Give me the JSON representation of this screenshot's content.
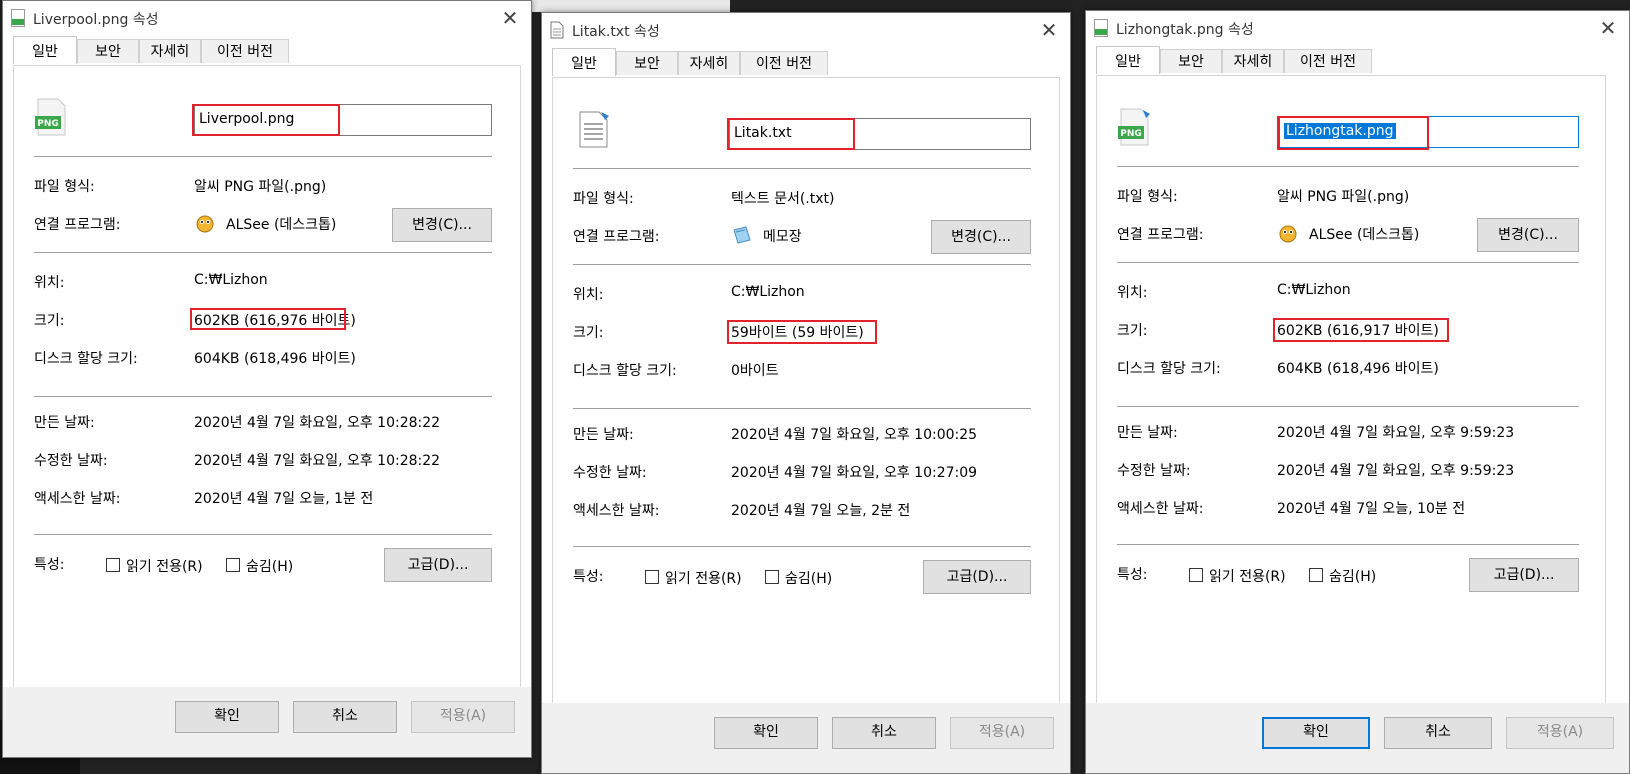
{
  "windows": [
    {
      "title": "Liverpool.png 속성",
      "file_name": "Liverpool.png",
      "icon": "png-file-icon",
      "file_type_label": "파일 형식:",
      "file_type": "알씨 PNG 파일(.png)",
      "opens_with_label": "연결 프로그램:",
      "opens_with": "ALSee (데스크톱)",
      "opens_with_icon": "alsee-app-icon",
      "change_button": "변경(C)...",
      "location_label": "위치:",
      "location": "C:₩Lizhon",
      "size_label": "크기:",
      "size": "602KB (616,976 바이트)",
      "disk_size_label": "디스크 할당 크기:",
      "disk_size": "604KB (618,496 바이트)",
      "created_label": "만든 날짜:",
      "created": "2020년 4월 7일 화요일, 오후 10:28:22",
      "modified_label": "수정한 날짜:",
      "modified": "2020년 4월 7일 화요일, 오후 10:28:22",
      "accessed_label": "액세스한 날짜:",
      "accessed": "2020년 4월 7일 오늘, 1분 전",
      "attributes_label": "특성:",
      "readonly_label": "읽기 전용(R)",
      "hidden_label": "숨김(H)",
      "advanced_button": "고급(D)...",
      "ok_button": "확인",
      "cancel_button": "취소",
      "apply_button": "적용(A)"
    },
    {
      "title": "Litak.txt 속성",
      "file_name": "Litak.txt",
      "icon": "text-file-icon",
      "file_type_label": "파일 형식:",
      "file_type": "텍스트 문서(.txt)",
      "opens_with_label": "연결 프로그램:",
      "opens_with": "메모장",
      "opens_with_icon": "notepad-app-icon",
      "change_button": "변경(C)...",
      "location_label": "위치:",
      "location": "C:₩Lizhon",
      "size_label": "크기:",
      "size": "59바이트 (59 바이트)",
      "disk_size_label": "디스크 할당 크기:",
      "disk_size": "0바이트",
      "created_label": "만든 날짜:",
      "created": "2020년 4월 7일 화요일, 오후 10:00:25",
      "modified_label": "수정한 날짜:",
      "modified": "2020년 4월 7일 화요일, 오후 10:27:09",
      "accessed_label": "액세스한 날짜:",
      "accessed": "2020년 4월 7일 오늘, 2분 전",
      "attributes_label": "특성:",
      "readonly_label": "읽기 전용(R)",
      "hidden_label": "숨김(H)",
      "advanced_button": "고급(D)...",
      "ok_button": "확인",
      "cancel_button": "취소",
      "apply_button": "적용(A)"
    },
    {
      "title": "Lizhongtak.png 속성",
      "file_name": "Lizhongtak.png",
      "icon": "png-file-icon",
      "file_type_label": "파일 형식:",
      "file_type": "알씨 PNG 파일(.png)",
      "opens_with_label": "연결 프로그램:",
      "opens_with": "ALSee (데스크톱)",
      "opens_with_icon": "alsee-app-icon",
      "change_button": "변경(C)...",
      "location_label": "위치:",
      "location": "C:₩Lizhon",
      "size_label": "크기:",
      "size": "602KB (616,917 바이트)",
      "disk_size_label": "디스크 할당 크기:",
      "disk_size": "604KB (618,496 바이트)",
      "created_label": "만든 날짜:",
      "created": "2020년 4월 7일 화요일, 오후 9:59:23",
      "modified_label": "수정한 날짜:",
      "modified": "2020년 4월 7일 화요일, 오후 9:59:23",
      "accessed_label": "액세스한 날짜:",
      "accessed": "2020년 4월 7일 오늘, 10분 전",
      "attributes_label": "특성:",
      "readonly_label": "읽기 전용(R)",
      "hidden_label": "숨김(H)",
      "advanced_button": "고급(D)...",
      "ok_button": "확인",
      "cancel_button": "취소",
      "apply_button": "적용(A)"
    }
  ],
  "tabs": [
    "일반",
    "보안",
    "자세히",
    "이전 버전"
  ],
  "icon_labels": {
    "png": "PNG"
  },
  "colors": {
    "highlight_box": "#e3232c",
    "selection": "#0078d7",
    "dialog_bg": "#f0f0f0"
  }
}
